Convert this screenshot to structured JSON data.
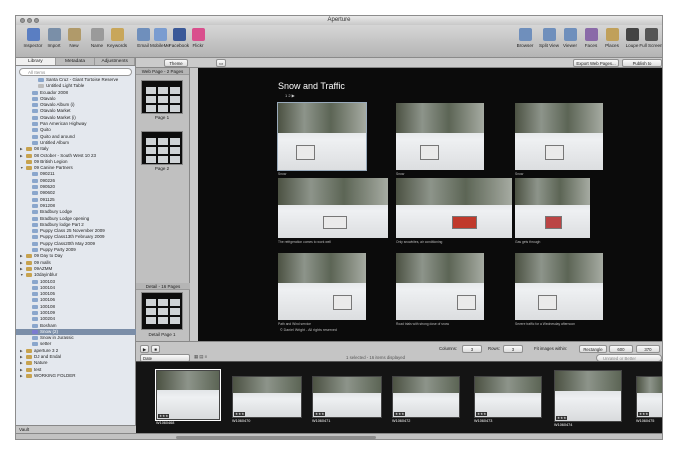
{
  "app_title": "Aperture",
  "toolbar": {
    "left": [
      {
        "label": "Inspector",
        "icon": "info-icon",
        "color": "#5a7ec2"
      },
      {
        "label": "Import",
        "icon": "import-icon",
        "color": "#7a8fa8"
      },
      {
        "label": "New",
        "icon": "new-icon",
        "color": "#b09a6a"
      },
      {
        "label": "Name",
        "icon": "name-icon",
        "color": "#9a9a9a"
      },
      {
        "label": "Keywords",
        "icon": "keywords-icon",
        "color": "#c8a65a"
      },
      {
        "label": "Email",
        "icon": "email-icon",
        "color": "#6f8fbc"
      },
      {
        "label": "MobileMe",
        "icon": "mobileme-icon",
        "color": "#7a9cd0"
      },
      {
        "label": "Facebook",
        "icon": "facebook-icon",
        "color": "#3b5998"
      },
      {
        "label": "Flickr",
        "icon": "flickr-icon",
        "color": "#d94f8d"
      }
    ],
    "right": [
      {
        "label": "Browser",
        "icon": "browser-icon",
        "color": "#6f8fbc"
      },
      {
        "label": "Split View",
        "icon": "split-view-icon",
        "color": "#6f8fbc"
      },
      {
        "label": "Viewer",
        "icon": "viewer-icon",
        "color": "#6f8fbc"
      },
      {
        "label": "Faces",
        "icon": "faces-icon",
        "color": "#8a6aa8"
      },
      {
        "label": "Places",
        "icon": "places-icon",
        "color": "#c0a05a"
      },
      {
        "label": "Loupe",
        "icon": "loupe-icon",
        "color": "#444444"
      },
      {
        "label": "Full Screen",
        "icon": "full-screen-icon",
        "color": "#555555"
      }
    ]
  },
  "left": {
    "tabs": [
      "Library",
      "Metadata",
      "Adjustments"
    ],
    "search_placeholder": "All Items",
    "items": [
      {
        "label": "Santa Cruz - Giant Tortoise Reserve",
        "indent": 3,
        "type": "album"
      },
      {
        "label": "Untitled Light Table",
        "indent": 3,
        "type": "light"
      },
      {
        "label": "Ecuador 2008",
        "indent": 2,
        "type": "album"
      },
      {
        "label": "Otavalo",
        "indent": 2,
        "type": "album"
      },
      {
        "label": "Otavalo Album (i)",
        "indent": 2,
        "type": "album"
      },
      {
        "label": "Otavalo Market",
        "indent": 2,
        "type": "album"
      },
      {
        "label": "Otavalo Market (i)",
        "indent": 2,
        "type": "album"
      },
      {
        "label": "Pan American Highway",
        "indent": 2,
        "type": "album"
      },
      {
        "label": "Quito",
        "indent": 2,
        "type": "album"
      },
      {
        "label": "Quito and around",
        "indent": 2,
        "type": "album"
      },
      {
        "label": "Untitled Album",
        "indent": 2,
        "type": "album"
      },
      {
        "label": "08 Italy",
        "indent": 1,
        "type": "folder",
        "tri": "▶"
      },
      {
        "label": "08 October - South West 10 23",
        "indent": 1,
        "type": "folder",
        "tri": "▶"
      },
      {
        "label": "09 British Legion",
        "indent": 1,
        "type": "folder"
      },
      {
        "label": "09 Canine Partners",
        "indent": 1,
        "type": "folder",
        "tri": "▼"
      },
      {
        "label": "090211",
        "indent": 2,
        "type": "album"
      },
      {
        "label": "090226",
        "indent": 2,
        "type": "album"
      },
      {
        "label": "090520",
        "indent": 2,
        "type": "album"
      },
      {
        "label": "090602",
        "indent": 2,
        "type": "album"
      },
      {
        "label": "091125",
        "indent": 2,
        "type": "album"
      },
      {
        "label": "091208",
        "indent": 2,
        "type": "album"
      },
      {
        "label": "Bradbury Lodge",
        "indent": 2,
        "type": "album"
      },
      {
        "label": "Bradbury Lodge opening",
        "indent": 2,
        "type": "album"
      },
      {
        "label": "Bradbury lodge Part 2",
        "indent": 2,
        "type": "album"
      },
      {
        "label": "Puppy Class 25 November 2009",
        "indent": 2,
        "type": "album"
      },
      {
        "label": "Puppy Class13th February 2009",
        "indent": 2,
        "type": "album"
      },
      {
        "label": "Puppy Class20th May 2009",
        "indent": 2,
        "type": "album"
      },
      {
        "label": "Puppy Party 2009",
        "indent": 2,
        "type": "album"
      },
      {
        "label": "09 Day to Day",
        "indent": 1,
        "type": "folder",
        "tri": "▶"
      },
      {
        "label": "09 malls",
        "indent": 1,
        "type": "folder",
        "tri": "▶"
      },
      {
        "label": "09AZMM",
        "indent": 1,
        "type": "folder",
        "tri": "▶"
      },
      {
        "label": "10dayinblur",
        "indent": 1,
        "type": "folder",
        "tri": "▼"
      },
      {
        "label": "100103",
        "indent": 2,
        "type": "album"
      },
      {
        "label": "100104",
        "indent": 2,
        "type": "album"
      },
      {
        "label": "100105",
        "indent": 2,
        "type": "album"
      },
      {
        "label": "100106",
        "indent": 2,
        "type": "album"
      },
      {
        "label": "100108",
        "indent": 2,
        "type": "album"
      },
      {
        "label": "100109",
        "indent": 2,
        "type": "album"
      },
      {
        "label": "100204",
        "indent": 2,
        "type": "album"
      },
      {
        "label": "Bosham",
        "indent": 2,
        "type": "album"
      },
      {
        "label": "Snow (2)",
        "indent": 2,
        "type": "web",
        "selected": true
      },
      {
        "label": "Snow in Jurassic",
        "indent": 2,
        "type": "album"
      },
      {
        "label": "setter",
        "indent": 2,
        "type": "album"
      },
      {
        "label": "aperture 3 2",
        "indent": 1,
        "type": "folder",
        "tri": "▶"
      },
      {
        "label": "DJ and Endal",
        "indent": 1,
        "type": "folder",
        "tri": "▶"
      },
      {
        "label": "Nature",
        "indent": 1,
        "type": "folder",
        "tri": "▶"
      },
      {
        "label": "test",
        "indent": 1,
        "type": "folder",
        "tri": "▶"
      },
      {
        "label": "WORKING FOLDER",
        "indent": 1,
        "type": "folder",
        "tri": "▶"
      }
    ],
    "footer": "Vault"
  },
  "topbar": {
    "theme_label": "Theme",
    "export_label": "Export Web Pages...",
    "publish_label": "Publish to MobileMe..."
  },
  "pages": {
    "header": "Web Page - 2 Pages",
    "page1": "Page 1",
    "page2": "Page 2",
    "detail_header": "Detail - 16 Pages",
    "detail_page": "Detail Page 1"
  },
  "webpage": {
    "title": "Snow and Traffic",
    "nav": "1  2  ▶",
    "footer": "© Daniel Wright - All rights reserved",
    "captions": [
      "Snow",
      "Snow",
      "Snow",
      "The refrigeration comes to work well",
      "Only snowbites, air conditioning",
      "Gas gets through",
      "Path and Wind service",
      "Road trials with strong dose of snow",
      "Severe traffic for a Wednesday afternoon"
    ]
  },
  "lower": {
    "sort": "Date",
    "columns_label": "Columns:",
    "columns": "3",
    "rows_label": "Rows:",
    "rows": "3",
    "fit_label": "Fit images within:",
    "fit": "Rectangle",
    "w": "600",
    "h": "370",
    "status": "1 selected - 16 items displayed",
    "filter_placeholder": "Unrated or Better"
  },
  "strip": {
    "items": [
      {
        "name": "W1060468",
        "selected": true
      },
      {
        "name": "W1060470"
      },
      {
        "name": "W1060471"
      },
      {
        "name": "W1060472"
      },
      {
        "name": "W1060473"
      },
      {
        "name": "W1060474"
      },
      {
        "name": "W1060475"
      }
    ],
    "stars": "★★★"
  }
}
